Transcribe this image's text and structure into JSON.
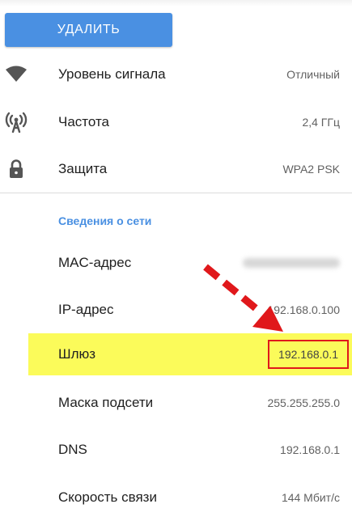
{
  "actions": {
    "delete_label": "УДАЛИТЬ"
  },
  "wifi_info": [
    {
      "label": "Уровень сигнала",
      "value": "Отличный",
      "icon": "wifi-signal-icon"
    },
    {
      "label": "Частота",
      "value": "2,4 ГГц",
      "icon": "antenna-icon"
    },
    {
      "label": "Защита",
      "value": "WPA2 PSK",
      "icon": "lock-icon"
    }
  ],
  "network_section": {
    "title": "Сведения о сети",
    "rows": [
      {
        "label": "MAC-адрес",
        "value": ""
      },
      {
        "label": "IP-адрес",
        "value": "192.168.0.100"
      },
      {
        "label": "Шлюз",
        "value": "192.168.0.1"
      },
      {
        "label": "Маска подсети",
        "value": "255.255.255.0"
      },
      {
        "label": "DNS",
        "value": "192.168.0.1"
      },
      {
        "label": "Скорость связи",
        "value": "144 Мбит/с"
      }
    ]
  },
  "colors": {
    "accent": "#4a90e2",
    "highlight": "#fbfb5a",
    "callout": "#e0181b"
  },
  "icons": {
    "arrow": "red-dashed-arrow"
  }
}
